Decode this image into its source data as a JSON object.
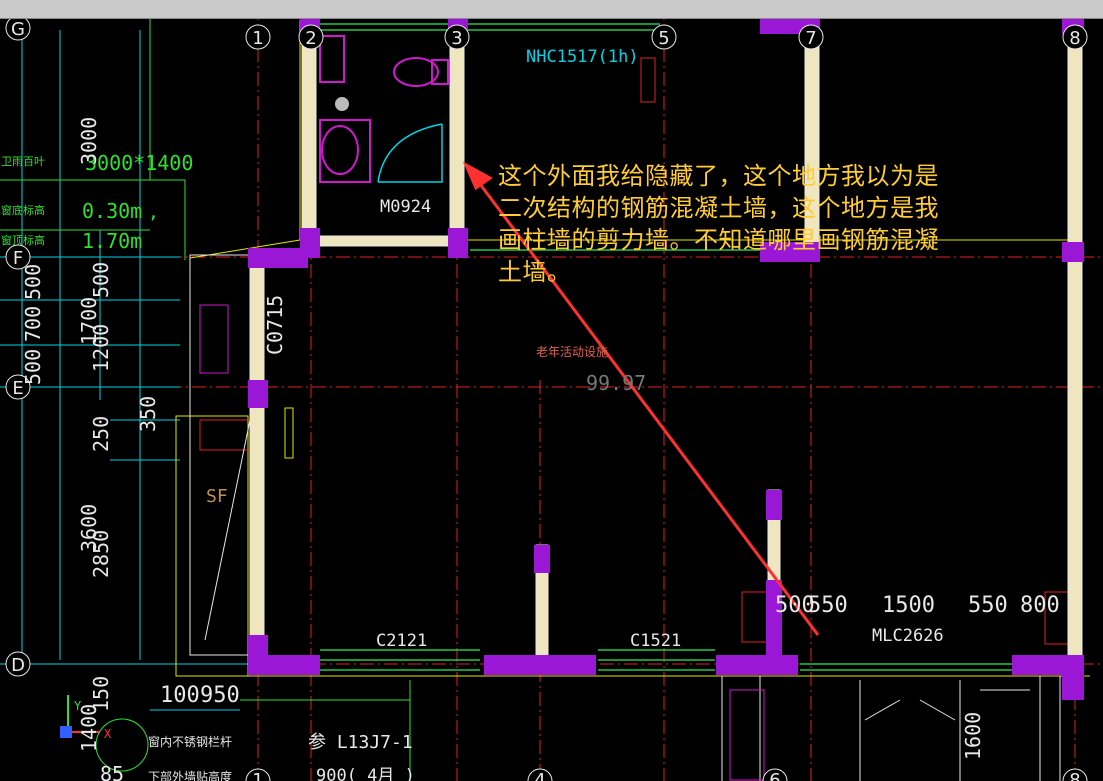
{
  "colors": {
    "wall": "#9b17d6",
    "line_green": "#27c44a",
    "line_cyan": "#00d4e6",
    "line_yellow": "#e6e600",
    "line_red": "#e02020",
    "line_white": "#e8e8e8",
    "annotation": "#ffcc33",
    "arrow": "#ff3030",
    "axis_red": "#ff3030",
    "axis_green": "#2fe12f"
  },
  "grid": {
    "columns": [
      "1",
      "2",
      "3",
      "5",
      "7",
      "8",
      "1",
      "4",
      "6",
      "8"
    ],
    "rows": [
      "G",
      "F",
      "E",
      "D"
    ]
  },
  "labels": {
    "top_door": "NHC1517(1h)",
    "door_m0924": "M0924",
    "window_c0715": "C0715",
    "window_c2121": "C2121",
    "window_c1521": "C1521",
    "door_mlc2626": "MLC2626",
    "room_name": "老年活动设施",
    "room_area": "99.97",
    "sf": "SF",
    "ref": "参 L13J7-1",
    "note_left": "窗内不锈钢栏杆",
    "note_bottom": "下部外墙贴高度",
    "bottom_dim": "900( 4月 )",
    "left_notes": [
      "卫雨百叶",
      "窗底标高",
      "窗顶标高"
    ]
  },
  "dims_left": {
    "top_val": "3000",
    "win_size": "3000*1400",
    "sill": "0.30m",
    "head": "1.70m",
    "d500a": "500",
    "d700": "700",
    "d500b": "500",
    "d1700": "1700",
    "d1200": "1200",
    "d500c": "500",
    "d250": "250",
    "d350": "350",
    "d3600": "3600",
    "d2850": "2850",
    "d150": "150",
    "d100": "100",
    "d1400": "1400",
    "d950": "950",
    "d85": "85",
    "comma": ","
  },
  "dims_right": {
    "d550a": "550",
    "d1500": "1500",
    "d550b": "550",
    "d800": "800",
    "d500": "500",
    "d1600": "1600"
  },
  "ucs": {
    "y": "Y",
    "x": "X"
  },
  "annotation": {
    "line1": "这个外面我给隐藏了，这个地方我以为是",
    "line2": "二次结构的钢筋混凝土墙，这个地方是我",
    "line3": "画柱墙的剪力墙。不知道哪里画钢筋混凝",
    "line4": "土墙。"
  }
}
